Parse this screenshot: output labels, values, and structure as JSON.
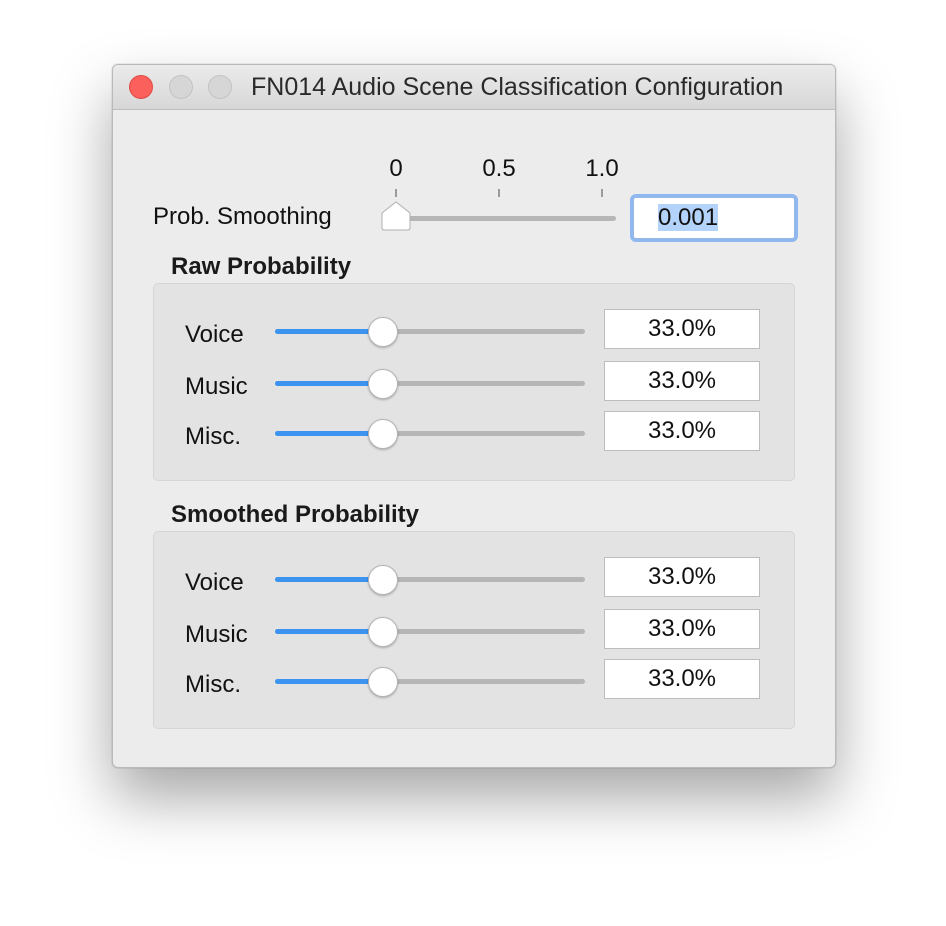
{
  "window": {
    "title": "FN014 Audio Scene Classification Configuration"
  },
  "smoothing": {
    "label": "Prob. Smoothing",
    "ticks": [
      "0",
      "0.5",
      "1.0"
    ],
    "value": "0.001",
    "slider_fraction": 0.001
  },
  "raw": {
    "title": "Raw Probability",
    "rows": [
      {
        "label": "Voice",
        "value": "33.0%",
        "fraction": 0.33
      },
      {
        "label": "Music",
        "value": "33.0%",
        "fraction": 0.33
      },
      {
        "label": "Misc.",
        "value": "33.0%",
        "fraction": 0.33
      }
    ]
  },
  "smoothed": {
    "title": "Smoothed Probability",
    "rows": [
      {
        "label": "Voice",
        "value": "33.0%",
        "fraction": 0.33
      },
      {
        "label": "Music",
        "value": "33.0%",
        "fraction": 0.33
      },
      {
        "label": "Misc.",
        "value": "33.0%",
        "fraction": 0.33
      }
    ]
  },
  "colors": {
    "accent": "#3c93f0",
    "close_button": "#fc605c"
  }
}
